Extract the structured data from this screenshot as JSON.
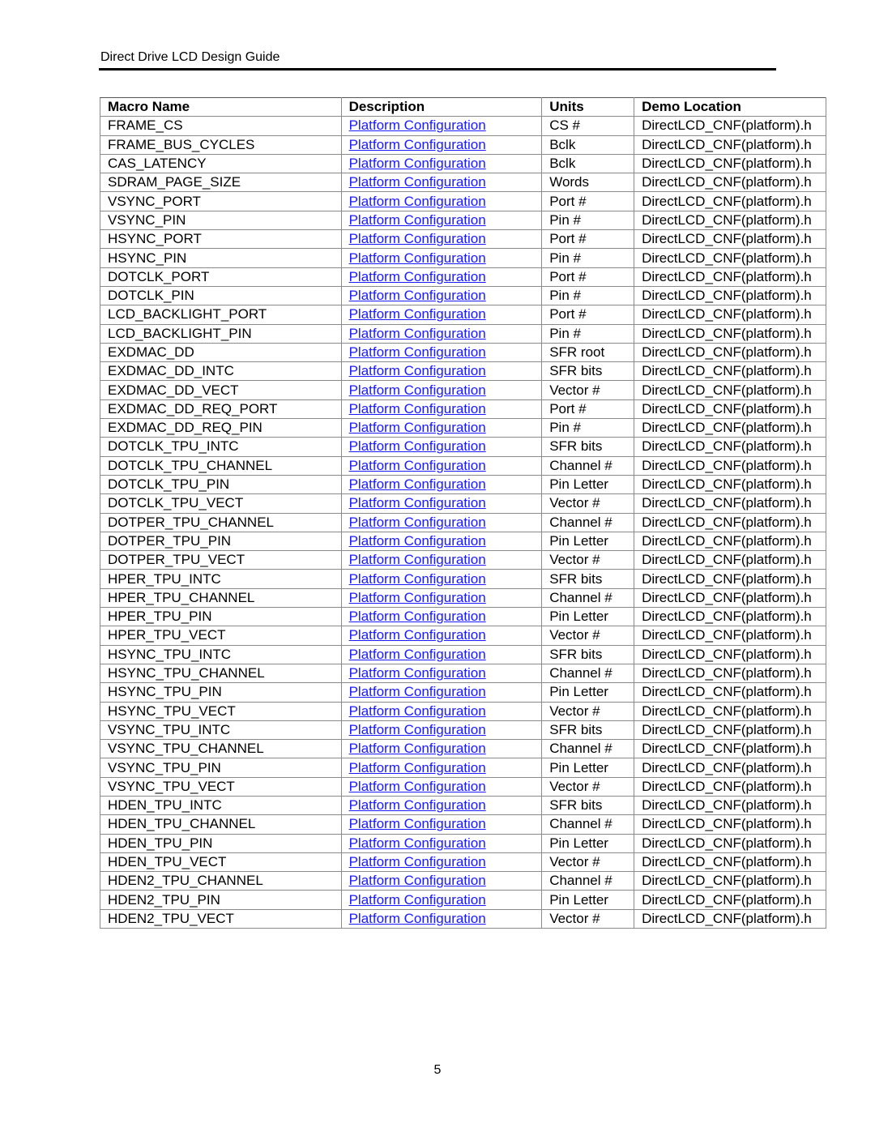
{
  "header": {
    "title": "Direct Drive LCD Design Guide"
  },
  "table": {
    "columns": [
      "Macro Name",
      "Description",
      "Units",
      "Demo Location"
    ],
    "description_link": "Platform Configuration",
    "location": "DirectLCD_CNF(platform).h",
    "rows": [
      [
        "FRAME_CS",
        "CS #"
      ],
      [
        "FRAME_BUS_CYCLES",
        "Bclk"
      ],
      [
        "CAS_LATENCY",
        "Bclk"
      ],
      [
        "SDRAM_PAGE_SIZE",
        "Words"
      ],
      [
        "VSYNC_PORT",
        "Port #"
      ],
      [
        "VSYNC_PIN",
        "Pin #"
      ],
      [
        "HSYNC_PORT",
        "Port #"
      ],
      [
        "HSYNC_PIN",
        "Pin #"
      ],
      [
        "DOTCLK_PORT",
        "Port #"
      ],
      [
        "DOTCLK_PIN",
        "Pin #"
      ],
      [
        "LCD_BACKLIGHT_PORT",
        "Port #"
      ],
      [
        "LCD_BACKLIGHT_PIN",
        "Pin #"
      ],
      [
        "EXDMAC_DD",
        "SFR root"
      ],
      [
        "EXDMAC_DD_INTC",
        "SFR bits"
      ],
      [
        "EXDMAC_DD_VECT",
        "Vector #"
      ],
      [
        "EXDMAC_DD_REQ_PORT",
        "Port #"
      ],
      [
        "EXDMAC_DD_REQ_PIN",
        "Pin #"
      ],
      [
        "DOTCLK_TPU_INTC",
        "SFR bits"
      ],
      [
        "DOTCLK_TPU_CHANNEL",
        "Channel #"
      ],
      [
        "DOTCLK_TPU_PIN",
        "Pin Letter"
      ],
      [
        "DOTCLK_TPU_VECT",
        "Vector #"
      ],
      [
        "DOTPER_TPU_CHANNEL",
        "Channel #"
      ],
      [
        "DOTPER_TPU_PIN",
        "Pin Letter"
      ],
      [
        "DOTPER_TPU_VECT",
        "Vector #"
      ],
      [
        "HPER_TPU_INTC",
        "SFR bits"
      ],
      [
        "HPER_TPU_CHANNEL",
        "Channel #"
      ],
      [
        "HPER_TPU_PIN",
        "Pin Letter"
      ],
      [
        "HPER_TPU_VECT",
        "Vector #"
      ],
      [
        "HSYNC_TPU_INTC",
        "SFR bits"
      ],
      [
        "HSYNC_TPU_CHANNEL",
        "Channel #"
      ],
      [
        "HSYNC_TPU_PIN",
        "Pin Letter"
      ],
      [
        "HSYNC_TPU_VECT",
        "Vector #"
      ],
      [
        "VSYNC_TPU_INTC",
        "SFR bits"
      ],
      [
        "VSYNC_TPU_CHANNEL",
        "Channel #"
      ],
      [
        "VSYNC_TPU_PIN",
        "Pin Letter"
      ],
      [
        "VSYNC_TPU_VECT",
        "Vector #"
      ],
      [
        "HDEN_TPU_INTC",
        "SFR bits"
      ],
      [
        "HDEN_TPU_CHANNEL",
        "Channel #"
      ],
      [
        "HDEN_TPU_PIN",
        "Pin Letter"
      ],
      [
        "HDEN_TPU_VECT",
        "Vector #"
      ],
      [
        "HDEN2_TPU_CHANNEL",
        "Channel #"
      ],
      [
        "HDEN2_TPU_PIN",
        "Pin Letter"
      ],
      [
        "HDEN2_TPU_VECT",
        "Vector #"
      ]
    ]
  },
  "footer": {
    "page_number": "5"
  }
}
